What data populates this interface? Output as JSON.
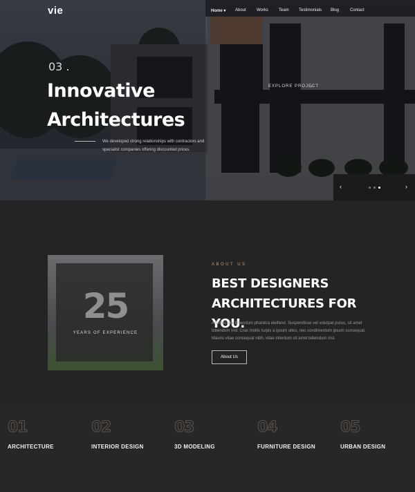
{
  "brand": {
    "logo": "vie"
  },
  "nav": {
    "items": [
      "Home ▾",
      "About",
      "Works",
      "Team",
      "Testimonials",
      "Blog",
      "Contact"
    ]
  },
  "hero": {
    "slide_number": "03 .",
    "title": "Innovative Architectures",
    "description": "We developed strong relationships with contractors and specialist companies offering discounted prices.",
    "explore_label": "EXPLORE PROJECT",
    "explore_arrow": "›",
    "prev_arrow": "‹",
    "next_arrow": "›"
  },
  "about": {
    "years_number": "25",
    "years_label": "YEARS OF EXPERIENCE",
    "label": "ABOUT US",
    "title": "BEST DESIGNERS ARCHITECTURES FOR YOU.",
    "text": "Architecture bibendum pharetra eleifend. Suspendisse vel volutpat purus, sit amet bibendum nisl. Cras mollis turpis a ipsum ultes, nec condimentum ipsum consequat. Mauris vitae consequat nibh, vitae interdum sit amet bibendum nisl.",
    "button_label": "About Us"
  },
  "services": [
    {
      "number": "01",
      "title": "ARCHITECTURE"
    },
    {
      "number": "02",
      "title": "INTERIOR DESIGN"
    },
    {
      "number": "03",
      "title": "3D MODELING"
    },
    {
      "number": "04",
      "title": "FURNITURE DESIGN"
    },
    {
      "number": "05",
      "title": "URBAN DESIGN"
    }
  ],
  "colors": {
    "accent": "#c59d7c",
    "background": "#242424"
  }
}
